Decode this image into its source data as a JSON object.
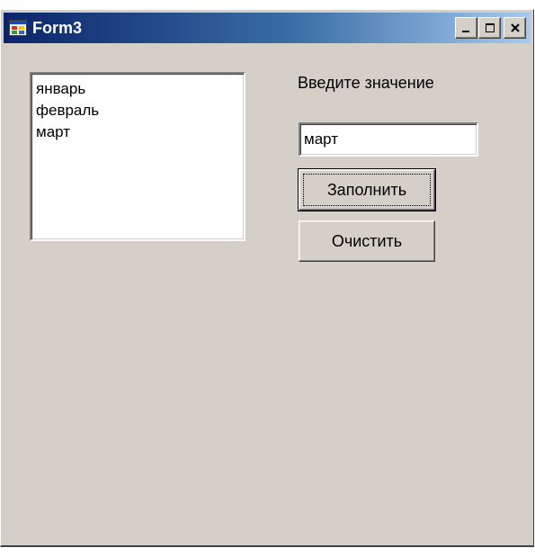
{
  "window": {
    "title": "Form3",
    "title_icon": "form-app-icon",
    "controls": {
      "minimize_icon": "minimize-icon",
      "maximize_icon": "maximize-icon",
      "close_icon": "close-icon"
    },
    "colors": {
      "titlebar_start": "#0a246a",
      "titlebar_end": "#a6caf0",
      "face": "#d4d0c8"
    }
  },
  "listbox": {
    "items": [
      "январь",
      "февраль",
      "март"
    ]
  },
  "prompt_label": "Введите значение",
  "input": {
    "value": "март"
  },
  "buttons": {
    "fill_label": "Заполнить",
    "clear_label": "Очистить"
  }
}
